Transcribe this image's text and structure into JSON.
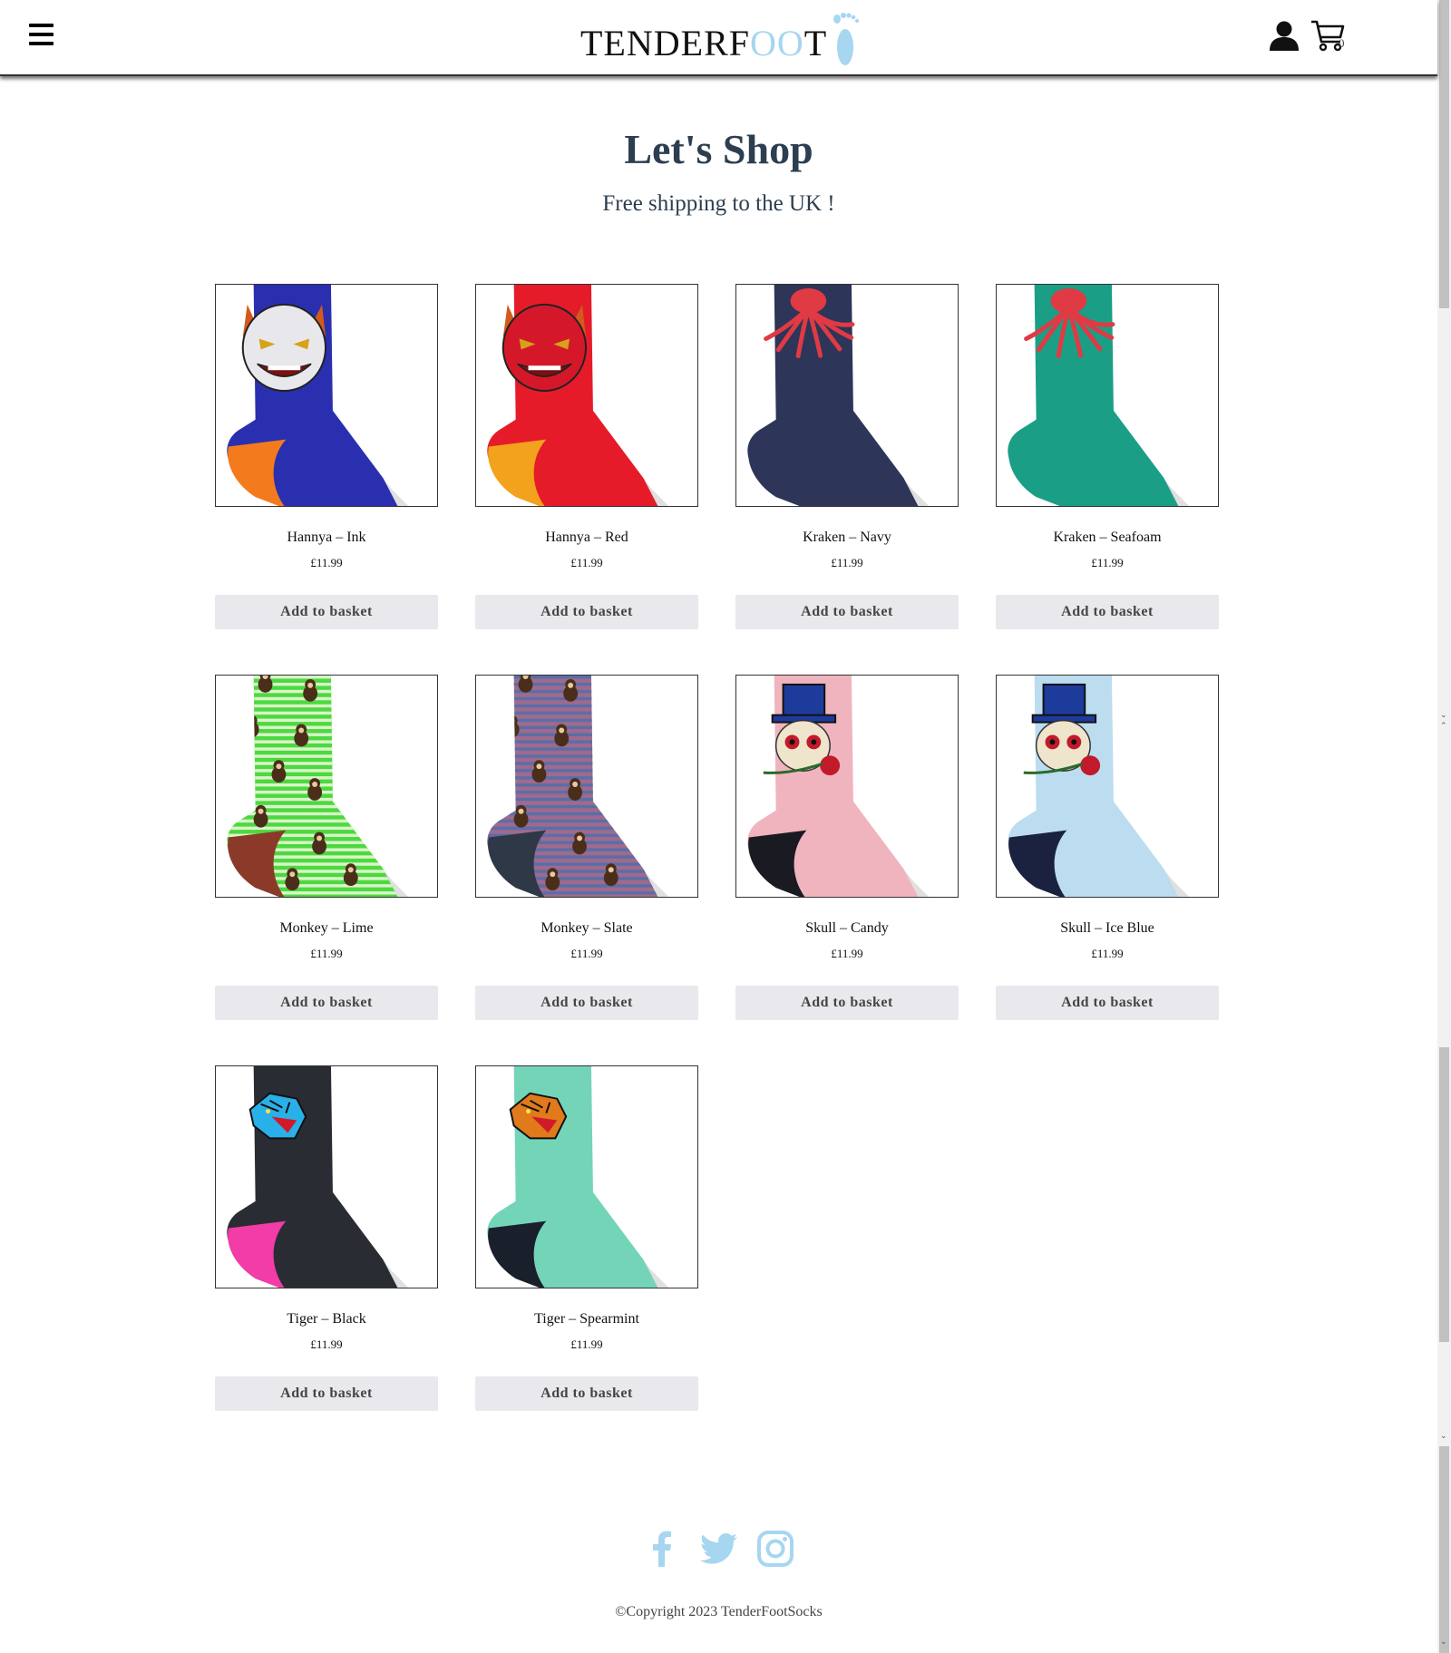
{
  "header": {
    "menu_icon": "hamburger-icon",
    "logo_prefix": "TENDERF",
    "logo_oo": "OO",
    "logo_suffix": "T",
    "account_icon": "user-icon",
    "cart_icon": "cart-icon",
    "cart_count": "0"
  },
  "hero": {
    "title": "Let's Shop",
    "subtitle": "Free shipping to the UK !"
  },
  "products": [
    {
      "name": "Hannya – Ink",
      "price": "£11.99",
      "button": "Add to basket",
      "colors": {
        "sock": "#2a2fb0",
        "heel": "#f47a1e",
        "motif": "mask-white"
      }
    },
    {
      "name": "Hannya – Red",
      "price": "£11.99",
      "button": "Add to basket",
      "colors": {
        "sock": "#e51b2a",
        "heel": "#f2a21c",
        "motif": "mask-red"
      }
    },
    {
      "name": "Kraken – Navy",
      "price": "£11.99",
      "button": "Add to basket",
      "colors": {
        "sock": "#2d3558",
        "heel": "#2d3558",
        "motif": "octopus"
      }
    },
    {
      "name": "Kraken – Seafoam",
      "price": "£11.99",
      "button": "Add to basket",
      "colors": {
        "sock": "#1b9e86",
        "heel": "#1b9e86",
        "motif": "octopus"
      }
    },
    {
      "name": "Monkey – Lime",
      "price": "£11.99",
      "button": "Add to basket",
      "colors": {
        "sock": "#4ed840",
        "heel": "#8b3a2a",
        "motif": "monkeys"
      }
    },
    {
      "name": "Monkey – Slate",
      "price": "£11.99",
      "button": "Add to basket",
      "colors": {
        "sock": "#a06a8c",
        "heel": "#2f3846",
        "motif": "monkeys"
      }
    },
    {
      "name": "Skull – Candy",
      "price": "£11.99",
      "button": "Add to basket",
      "colors": {
        "sock": "#f0b4bf",
        "heel": "#1a1a22",
        "motif": "skull"
      }
    },
    {
      "name": "Skull – Ice Blue",
      "price": "£11.99",
      "button": "Add to basket",
      "colors": {
        "sock": "#bcdcf0",
        "heel": "#1a2240",
        "motif": "skull"
      }
    },
    {
      "name": "Tiger – Black",
      "price": "£11.99",
      "button": "Add to basket",
      "colors": {
        "sock": "#2a2c34",
        "heel": "#f23ca8",
        "motif": "tiger-blue"
      }
    },
    {
      "name": "Tiger – Spearmint",
      "price": "£11.99",
      "button": "Add to basket",
      "colors": {
        "sock": "#74d4b8",
        "heel": "#1a1f2c",
        "motif": "tiger-orange"
      }
    }
  ],
  "footer": {
    "social": [
      "facebook-icon",
      "twitter-icon",
      "instagram-icon"
    ],
    "social_color": "#a6d6f0",
    "copyright": "©Copyright 2023 TenderFootSocks"
  }
}
